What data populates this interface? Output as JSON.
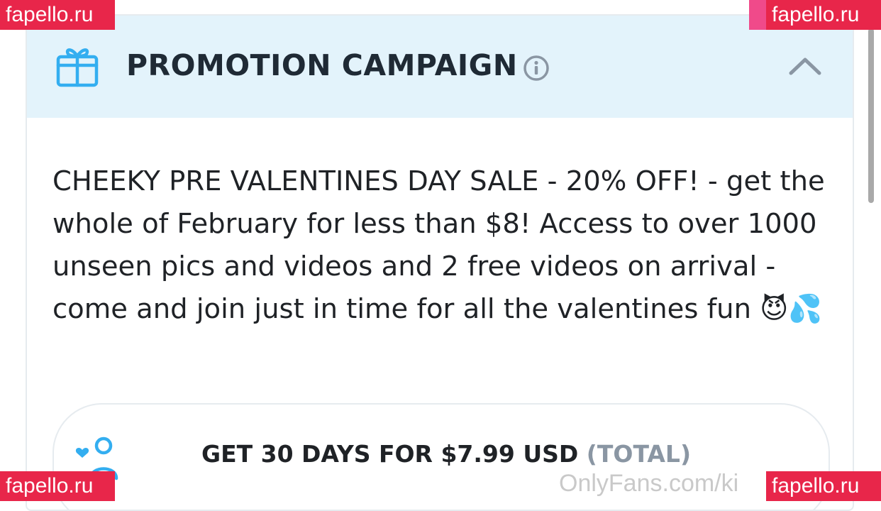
{
  "header": {
    "title": "PROMOTION CAMPAIGN",
    "icons": [
      "gift-icon",
      "info-icon",
      "chevron-up-icon"
    ]
  },
  "campaign": {
    "description": "CHEEKY PRE VALENTINES DAY SALE - 20% OFF! - get the whole of February for less than $8! Access to over 1000 unseen pics and videos and 2 free videos on arrival - come and join just in time for all the valentines fun 😈💦"
  },
  "offer": {
    "label": "GET 30 DAYS FOR $7.99 USD",
    "total_label": "(TOTAL)",
    "icon": "subscribe-user-icon"
  },
  "watermark": {
    "site_text": "OnlyFans.com/ki",
    "badge_text": "fapello.ru"
  },
  "colors": {
    "accent": "#00aff0",
    "header_bg": "#e3f3fb",
    "muted": "#8a96a3",
    "badge": "#e8264a"
  }
}
